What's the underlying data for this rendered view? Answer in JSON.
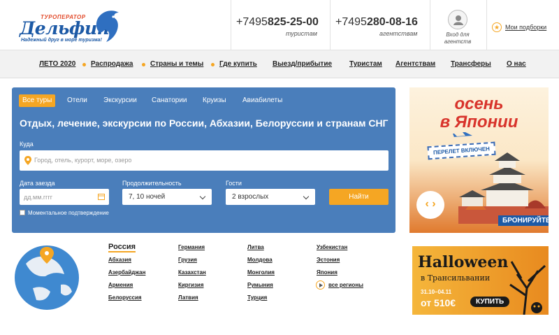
{
  "header": {
    "logo_small": "ТУРОПЕРАТОР",
    "logo_big": "Дельфин",
    "logo_tagline": "Надежный друг в море туризма!",
    "phone1_prefix": "+7495",
    "phone1_number": "825-25-00",
    "phone1_label": "туристам",
    "phone2_prefix": "+7495",
    "phone2_number": "280-08-16",
    "phone2_label": "агентствам",
    "agent_login": "Вход для агентств",
    "favorites": "Мои подборки"
  },
  "nav": {
    "items": [
      "ЛЕТО 2020",
      "Распродажа",
      "Страны и темы",
      "Где купить",
      "Выезд/прибытие",
      "Туристам",
      "Агентствам",
      "Трансферы",
      "О нас"
    ]
  },
  "search": {
    "tabs": [
      "Все туры",
      "Отели",
      "Экскурсии",
      "Санатории",
      "Круизы",
      "Авиабилеты"
    ],
    "heading": "Отдых, лечение, экскурсии по России, Абхазии, Белоруссии и странам СНГ",
    "where_label": "Куда",
    "where_placeholder": "Город, отель, курорт, море, озеро",
    "date_label": "Дата заезда",
    "date_placeholder": "дд.мм.гггг",
    "duration_label": "Продолжительность",
    "duration_value": "7, 10 ночей",
    "guests_label": "Гости",
    "guests_value": "2 взрослых",
    "find_button": "Найти",
    "instant_confirm": "Моментальное подтверждение"
  },
  "banner1": {
    "line1": "осень",
    "line2": "в Японии",
    "badge": "ПЕРЕЛЕТ ВКЛЮЧЕН",
    "book": "БРОНИРУЙТЕ"
  },
  "banner2": {
    "title": "Halloween",
    "subtitle": "в Трансильвании",
    "dates": "31.10–04.11",
    "price": "от 510€",
    "buy": "КУПИТЬ"
  },
  "countries": {
    "title": "Россия",
    "col1": [
      "Абхазия",
      "Азербайджан",
      "Армения",
      "Белоруссия"
    ],
    "col2": [
      "Германия",
      "Грузия",
      "Казахстан",
      "Киргизия",
      "Латвия"
    ],
    "col3": [
      "Литва",
      "Молдова",
      "Монголия",
      "Румыния",
      "Турция"
    ],
    "col4": [
      "Узбекистан",
      "Эстония",
      "Япония"
    ],
    "all_regions": "все регионы"
  },
  "colors": {
    "brand_blue": "#1d5aa6",
    "accent_orange": "#f5a623",
    "panel_blue": "#4a7ebb"
  }
}
